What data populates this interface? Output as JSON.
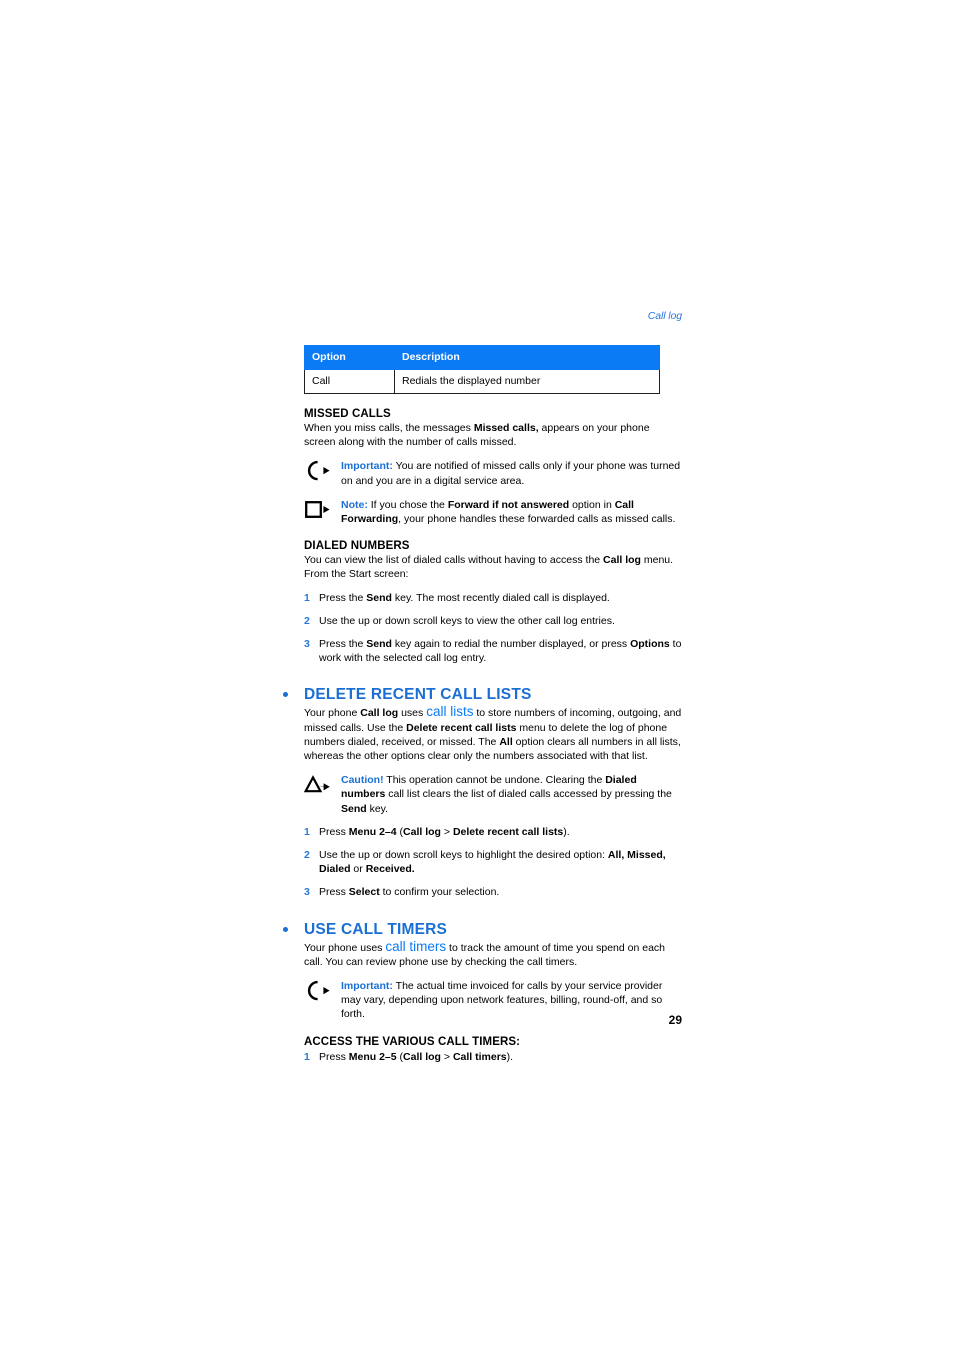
{
  "document": {
    "running_head": "Call log",
    "page_number": "29",
    "colors": {
      "table_header_blue": "#0a7bf5",
      "heading_blue": "#1a6fd4",
      "accent_blue": "#2878dc",
      "text_black": "#000000"
    }
  },
  "table": {
    "name": "options-table",
    "headers": [
      "Option",
      "Description"
    ],
    "rows": [
      {
        "option": "Call",
        "description": "Redials the displayed number"
      }
    ]
  },
  "missed_calls": {
    "heading": "MISSED CALLS",
    "intro_1": "When you miss calls, the messages ",
    "intro_bold": "Missed calls,",
    "intro_2": " appears on your phone screen along with the number of calls missed.",
    "callouts": [
      {
        "icon": "important-circle-arrow-icon",
        "label": "Important:",
        "text_1": " You are notified of missed calls only if your phone was turned on and you are in a digital service area."
      },
      {
        "icon": "note-square-arrow-icon",
        "label": "Note:",
        "text_1": "  If you chose the ",
        "bold_1": "Forward if not answered",
        "text_2": " option in ",
        "bold_2": "Call Forwarding",
        "text_3": ", your phone handles these forwarded calls as missed calls."
      }
    ]
  },
  "dialed_numbers": {
    "heading": "DIALED NUMBERS",
    "intro_1": "You can view the list of dialed calls without having to access the ",
    "intro_bold": "Call log",
    "intro_2": " menu. From the Start screen:",
    "steps": [
      {
        "num": "1",
        "text_1": "Press the ",
        "bold_1": "Send",
        "text_2": " key. The most recently dialed call is displayed."
      },
      {
        "num": "2",
        "text_1": "Use the up or down scroll keys to view the other call log entries.",
        "bold_1": "",
        "text_2": ""
      },
      {
        "num": "3",
        "text_1": "Press the ",
        "bold_1": "Send",
        "text_2": " key again to redial the number displayed, or press ",
        "bold_2": "Options",
        "text_3": " to work with the selected call log entry."
      }
    ]
  },
  "delete_recent_call_lists": {
    "heading": "DELETE RECENT CALL LISTS",
    "para_1": "Your phone ",
    "para_bold_1": "Call log",
    "para_2": " uses ",
    "para_accent": "call lists",
    "para_3": " to store numbers of incoming, outgoing, and missed calls. Use the ",
    "para_bold_2": "Delete recent call lists",
    "para_4": " menu to delete the log of phone numbers dialed, received, or missed. The ",
    "para_bold_3": "All",
    "para_5": " option clears all numbers in all lists, whereas the other options clear only the numbers associated with that list.",
    "callout": {
      "icon": "caution-triangle-arrow-icon",
      "label": "Caution!",
      "text_1": " This operation cannot be undone. Clearing the ",
      "bold_1": "Dialed numbers",
      "text_2": " call list clears the list of dialed calls accessed by pressing the ",
      "bold_2": "Send",
      "text_3": " key."
    },
    "steps": [
      {
        "num": "1",
        "text_1": "Press ",
        "bold_1": "Menu 2–4",
        "text_2": " (",
        "bold_2": "Call log",
        "text_3": " > ",
        "bold_3": "Delete recent call lists",
        "text_4": ")."
      },
      {
        "num": "2",
        "text_1": "Use the up or down scroll keys to highlight the desired option: ",
        "bold_1": "All, Missed, Dialed",
        "text_2": " or ",
        "bold_2": "Received.",
        "text_3": ""
      },
      {
        "num": "3",
        "text_1": "Press ",
        "bold_1": "Select",
        "text_2": " to confirm your selection.",
        "bold_2": "",
        "text_3": ""
      }
    ]
  },
  "use_call_timers": {
    "heading": "USE CALL TIMERS",
    "para_1": "Your phone uses ",
    "para_accent": "call timers",
    "para_2": " to track the amount of time you spend on each call. You can review phone use by checking the call timers.",
    "callout": {
      "icon": "important-circle-arrow-icon",
      "label": "Important:",
      "text_1": " The actual time invoiced for calls by your service provider may vary, depending upon network features, billing, round-off, and so forth."
    },
    "sub_heading": "ACCESS THE VARIOUS CALL TIMERS:",
    "steps": [
      {
        "num": "1",
        "text_1": "Press ",
        "bold_1": "Menu 2–5",
        "text_2": " (",
        "bold_2": "Call log",
        "text_3": " > ",
        "bold_3": "Call timers",
        "text_4": ")."
      }
    ]
  }
}
